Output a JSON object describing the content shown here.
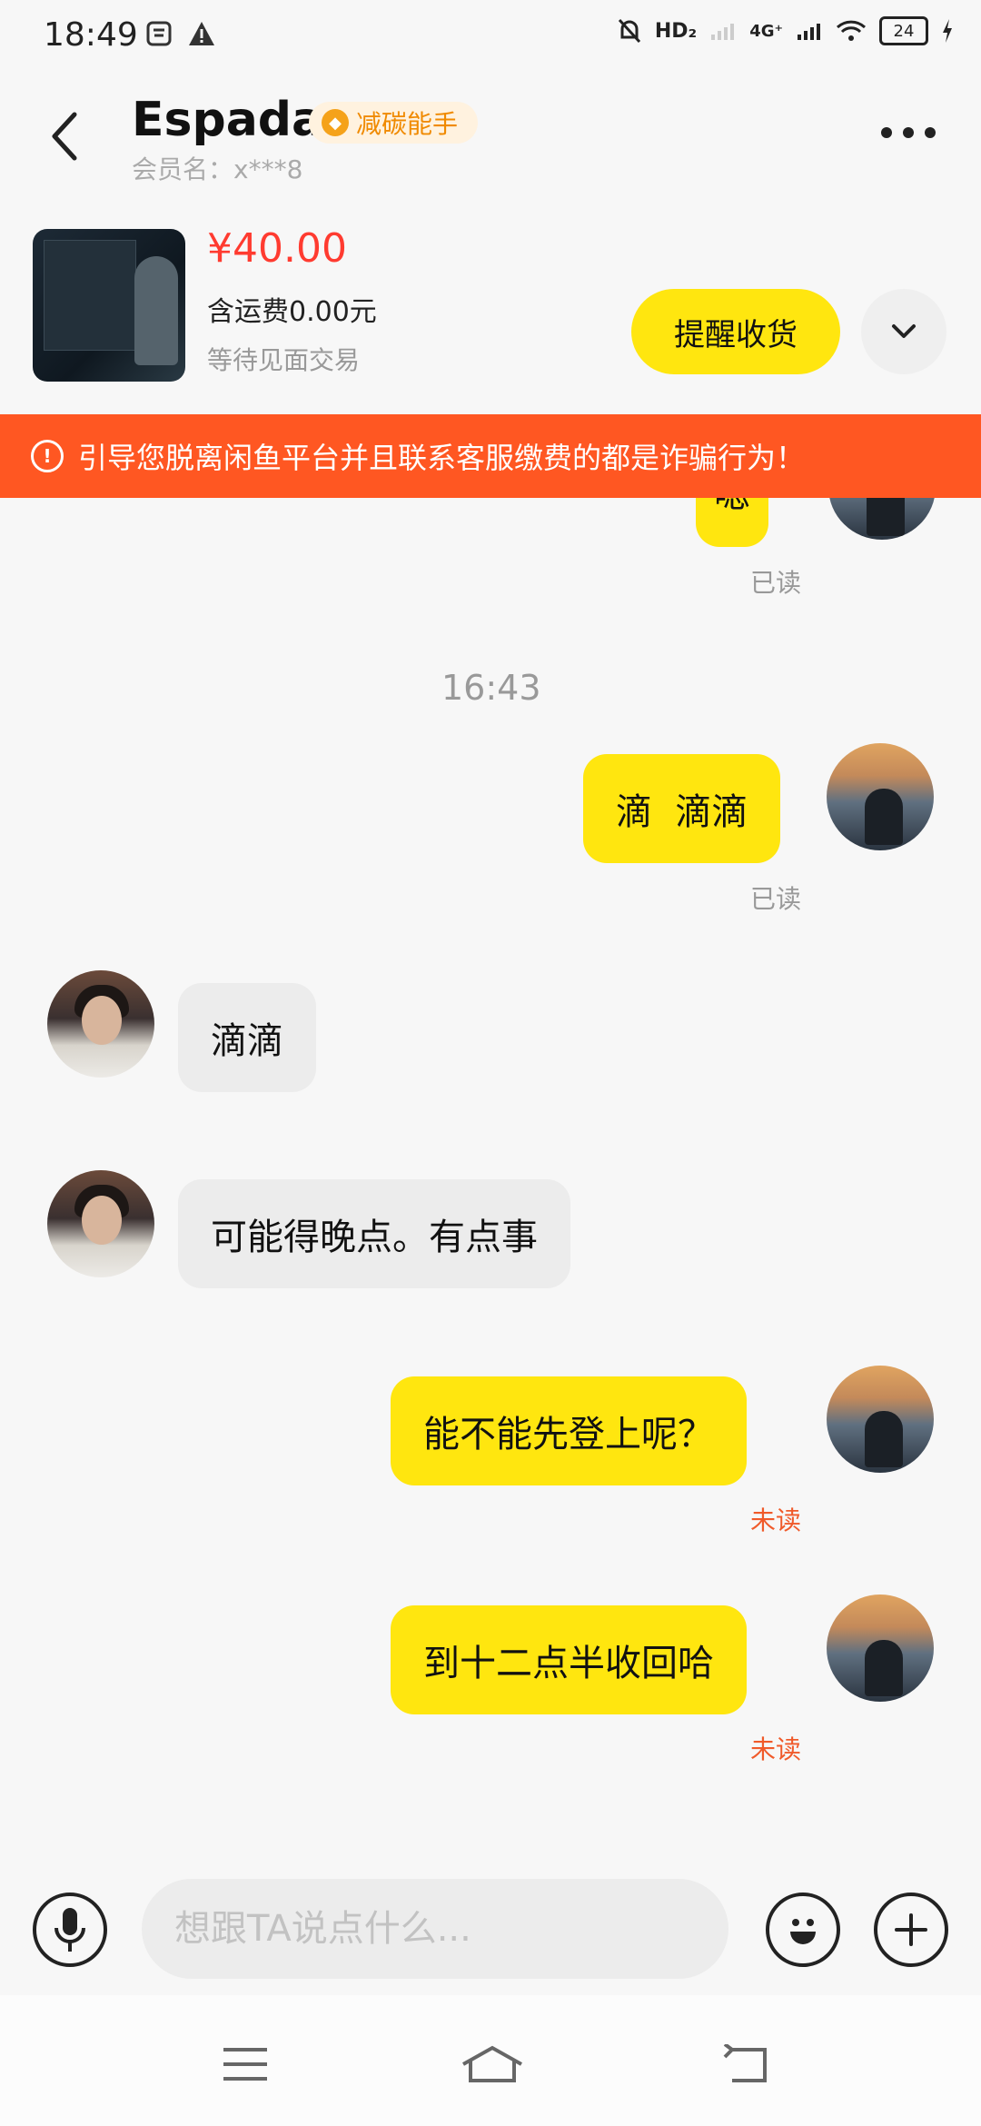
{
  "status_bar": {
    "time": "18:49",
    "network": "4G⁺",
    "hd": "HD₂",
    "battery": "24"
  },
  "header": {
    "title": "Espada",
    "badge": "减碳能手",
    "member": "会员名：x***8"
  },
  "product": {
    "price": "¥40.00",
    "shipping": "含运费0.00元",
    "status": "等待见面交易",
    "remind_button": "提醒收货"
  },
  "warning": "引导您脱离闲鱼平台并且联系客服缴费的都是诈骗行为！",
  "chat": {
    "partial_bubble": "嗯",
    "read1": "已读",
    "time_divider": "16:43",
    "msg1": "滴  滴滴",
    "read2": "已读",
    "msg2": "滴滴",
    "msg3": "可能得晚点。有点事",
    "msg4": "能不能先登上呢？",
    "unread1": "未读",
    "msg5": "到十二点半收回哈",
    "unread2": "未读"
  },
  "input": {
    "placeholder": "想跟TA说点什么..."
  },
  "colors": {
    "accent": "#ffe60f",
    "warning": "#ff5722",
    "price": "#ff3b30",
    "unread": "#f05a2a"
  }
}
